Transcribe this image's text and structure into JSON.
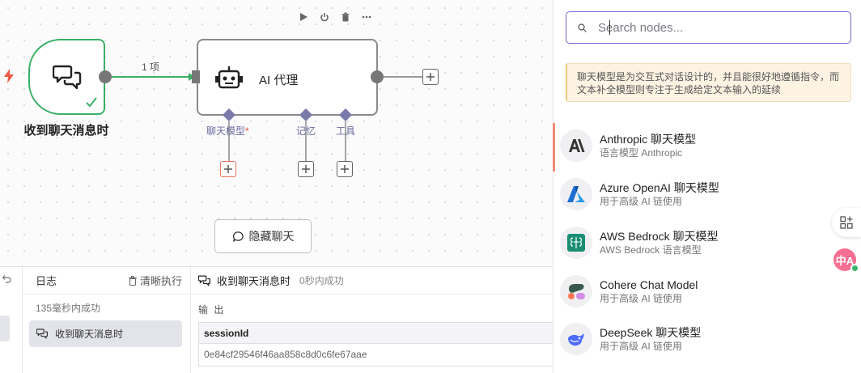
{
  "canvas": {
    "trigger_node": {
      "label": "收到聊天消息时",
      "icon": "chat-bubbles-icon",
      "status": "success"
    },
    "connection_label": "1 项",
    "agent_node": {
      "title": "AI 代理",
      "icon": "robot-icon",
      "sub_inputs": [
        {
          "label": "聊天模型",
          "required": true,
          "required_mark": "*"
        },
        {
          "label": "记忆",
          "required": false
        },
        {
          "label": "工具",
          "required": false
        }
      ]
    },
    "hide_chat_button": "隐藏聊天",
    "colors": {
      "success": "#3bae66",
      "required": "#e54d42",
      "accent": "#7068c8"
    }
  },
  "log_panel": {
    "title": "日志",
    "clear_button": "清晰执行",
    "summary": "135毫秒内成功",
    "items": [
      {
        "label": "收到聊天消息时"
      }
    ],
    "detail": {
      "node_name": "收到聊天消息时",
      "status": "0秒内成功",
      "output_label": "输 出",
      "table": {
        "header": "sessionId",
        "value": "0e84cf29546f46aa858c8d0c6fe67aae"
      }
    }
  },
  "node_panel": {
    "search": {
      "placeholder": "Search nodes...",
      "value": ""
    },
    "hint": "聊天模型是为交互式对话设计的，并且能很好地遵循指令，而文本补全模型则专注于生成给定文本输入的延续",
    "nodes": [
      {
        "name": "Anthropic 聊天模型",
        "desc": "语言模型 Anthropic",
        "icon": "anthropic-icon"
      },
      {
        "name": "Azure OpenAI 聊天模型",
        "desc": "用于高级 AI 链使用",
        "icon": "azure-icon"
      },
      {
        "name": "AWS Bedrock 聊天模型",
        "desc": "AWS Bedrock 语言模型",
        "icon": "aws-bedrock-icon"
      },
      {
        "name": "Cohere Chat Model",
        "desc": "用于高级 AI 链使用",
        "icon": "cohere-icon"
      },
      {
        "name": "DeepSeek 聊天模型",
        "desc": "用于高级 AI 链使用",
        "icon": "deepseek-icon"
      }
    ]
  }
}
